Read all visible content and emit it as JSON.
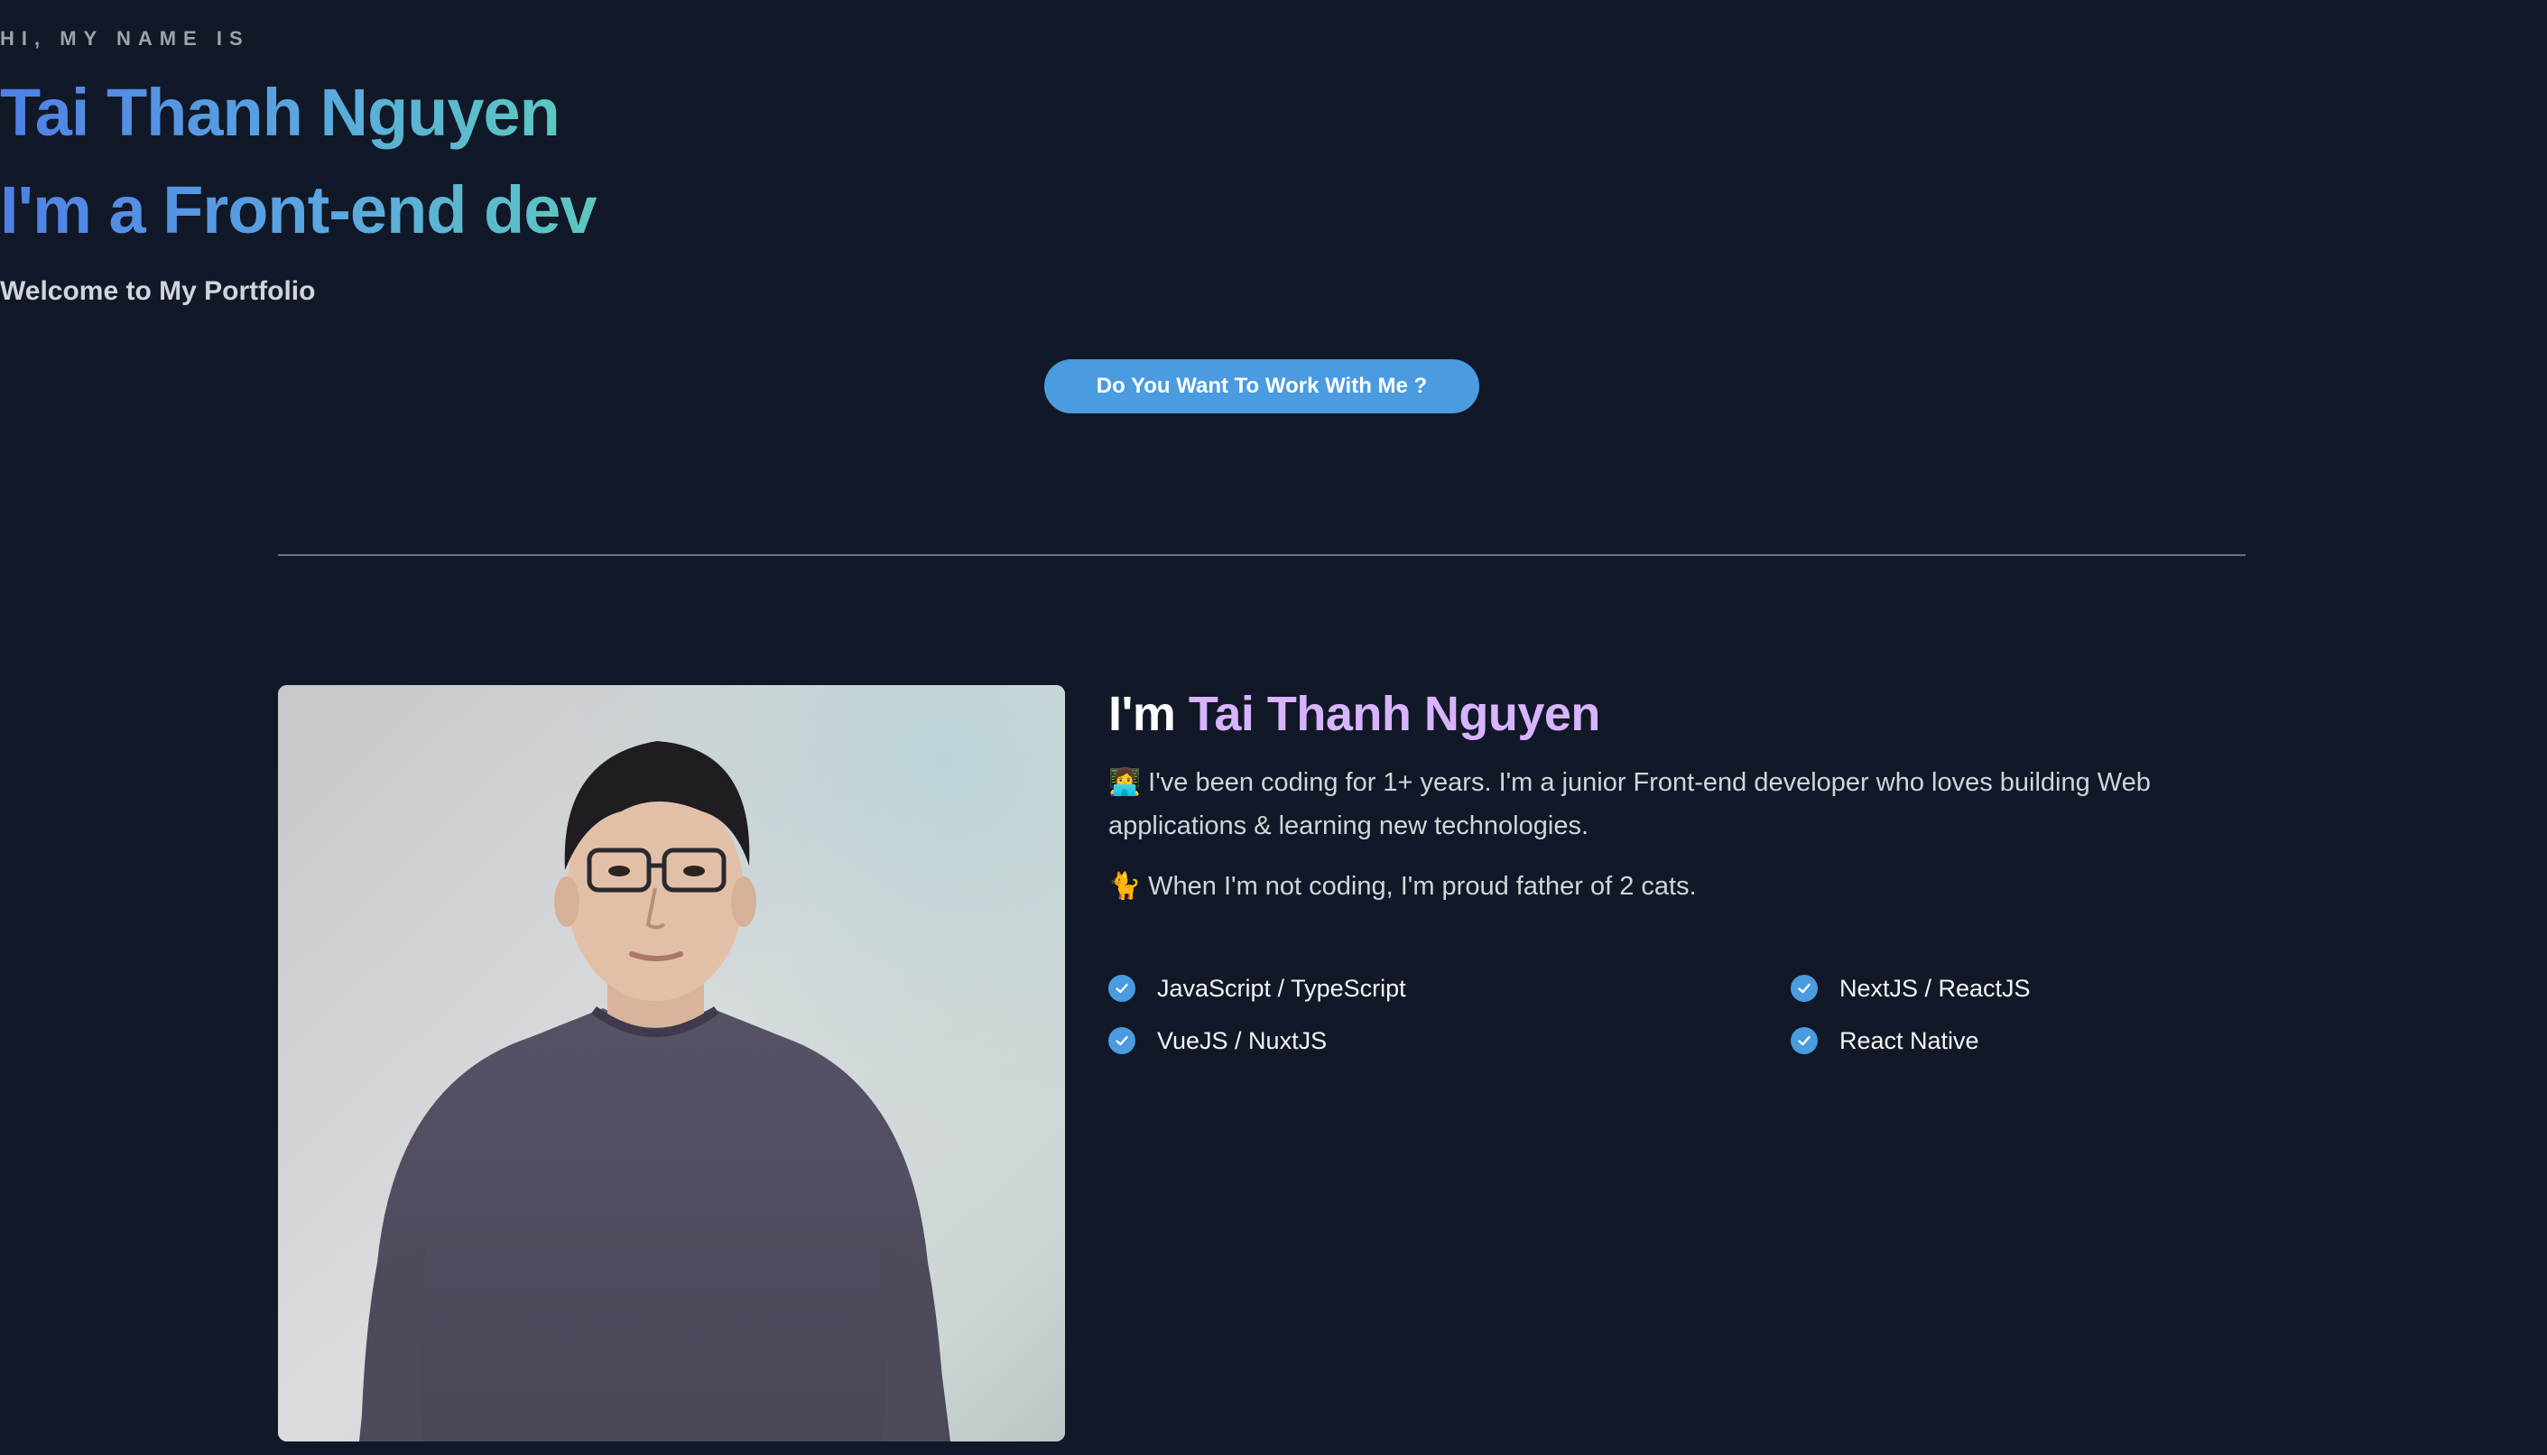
{
  "hero": {
    "eyebrow": "HI, MY NAME IS",
    "name": "Tai Thanh Nguyen",
    "role": "I'm a Front-end dev",
    "welcome": "Welcome to My Portfolio",
    "cta_label": "Do You Want To Work With Me ?"
  },
  "about": {
    "title_prefix": "I'm",
    "title_name": "Tai Thanh Nguyen",
    "paragraph_1": "👩‍💻 I've been coding for 1+ years. I'm a junior Front-end developer who loves building Web applications & learning new technologies.",
    "paragraph_2": "🐈 When I'm not coding, I'm proud father of 2 cats.",
    "skills": [
      "JavaScript / TypeScript",
      "NextJS / ReactJS",
      "VueJS / NuxtJS",
      "React Native"
    ]
  },
  "colors": {
    "background": "#111827",
    "accent_blue": "#4a9be0",
    "accent_purple": "#d8b4fe",
    "gradient_start": "#4f7fe6",
    "gradient_end": "#5cc8c0"
  },
  "icons": {
    "skill_bullet": "check-circle-icon"
  }
}
